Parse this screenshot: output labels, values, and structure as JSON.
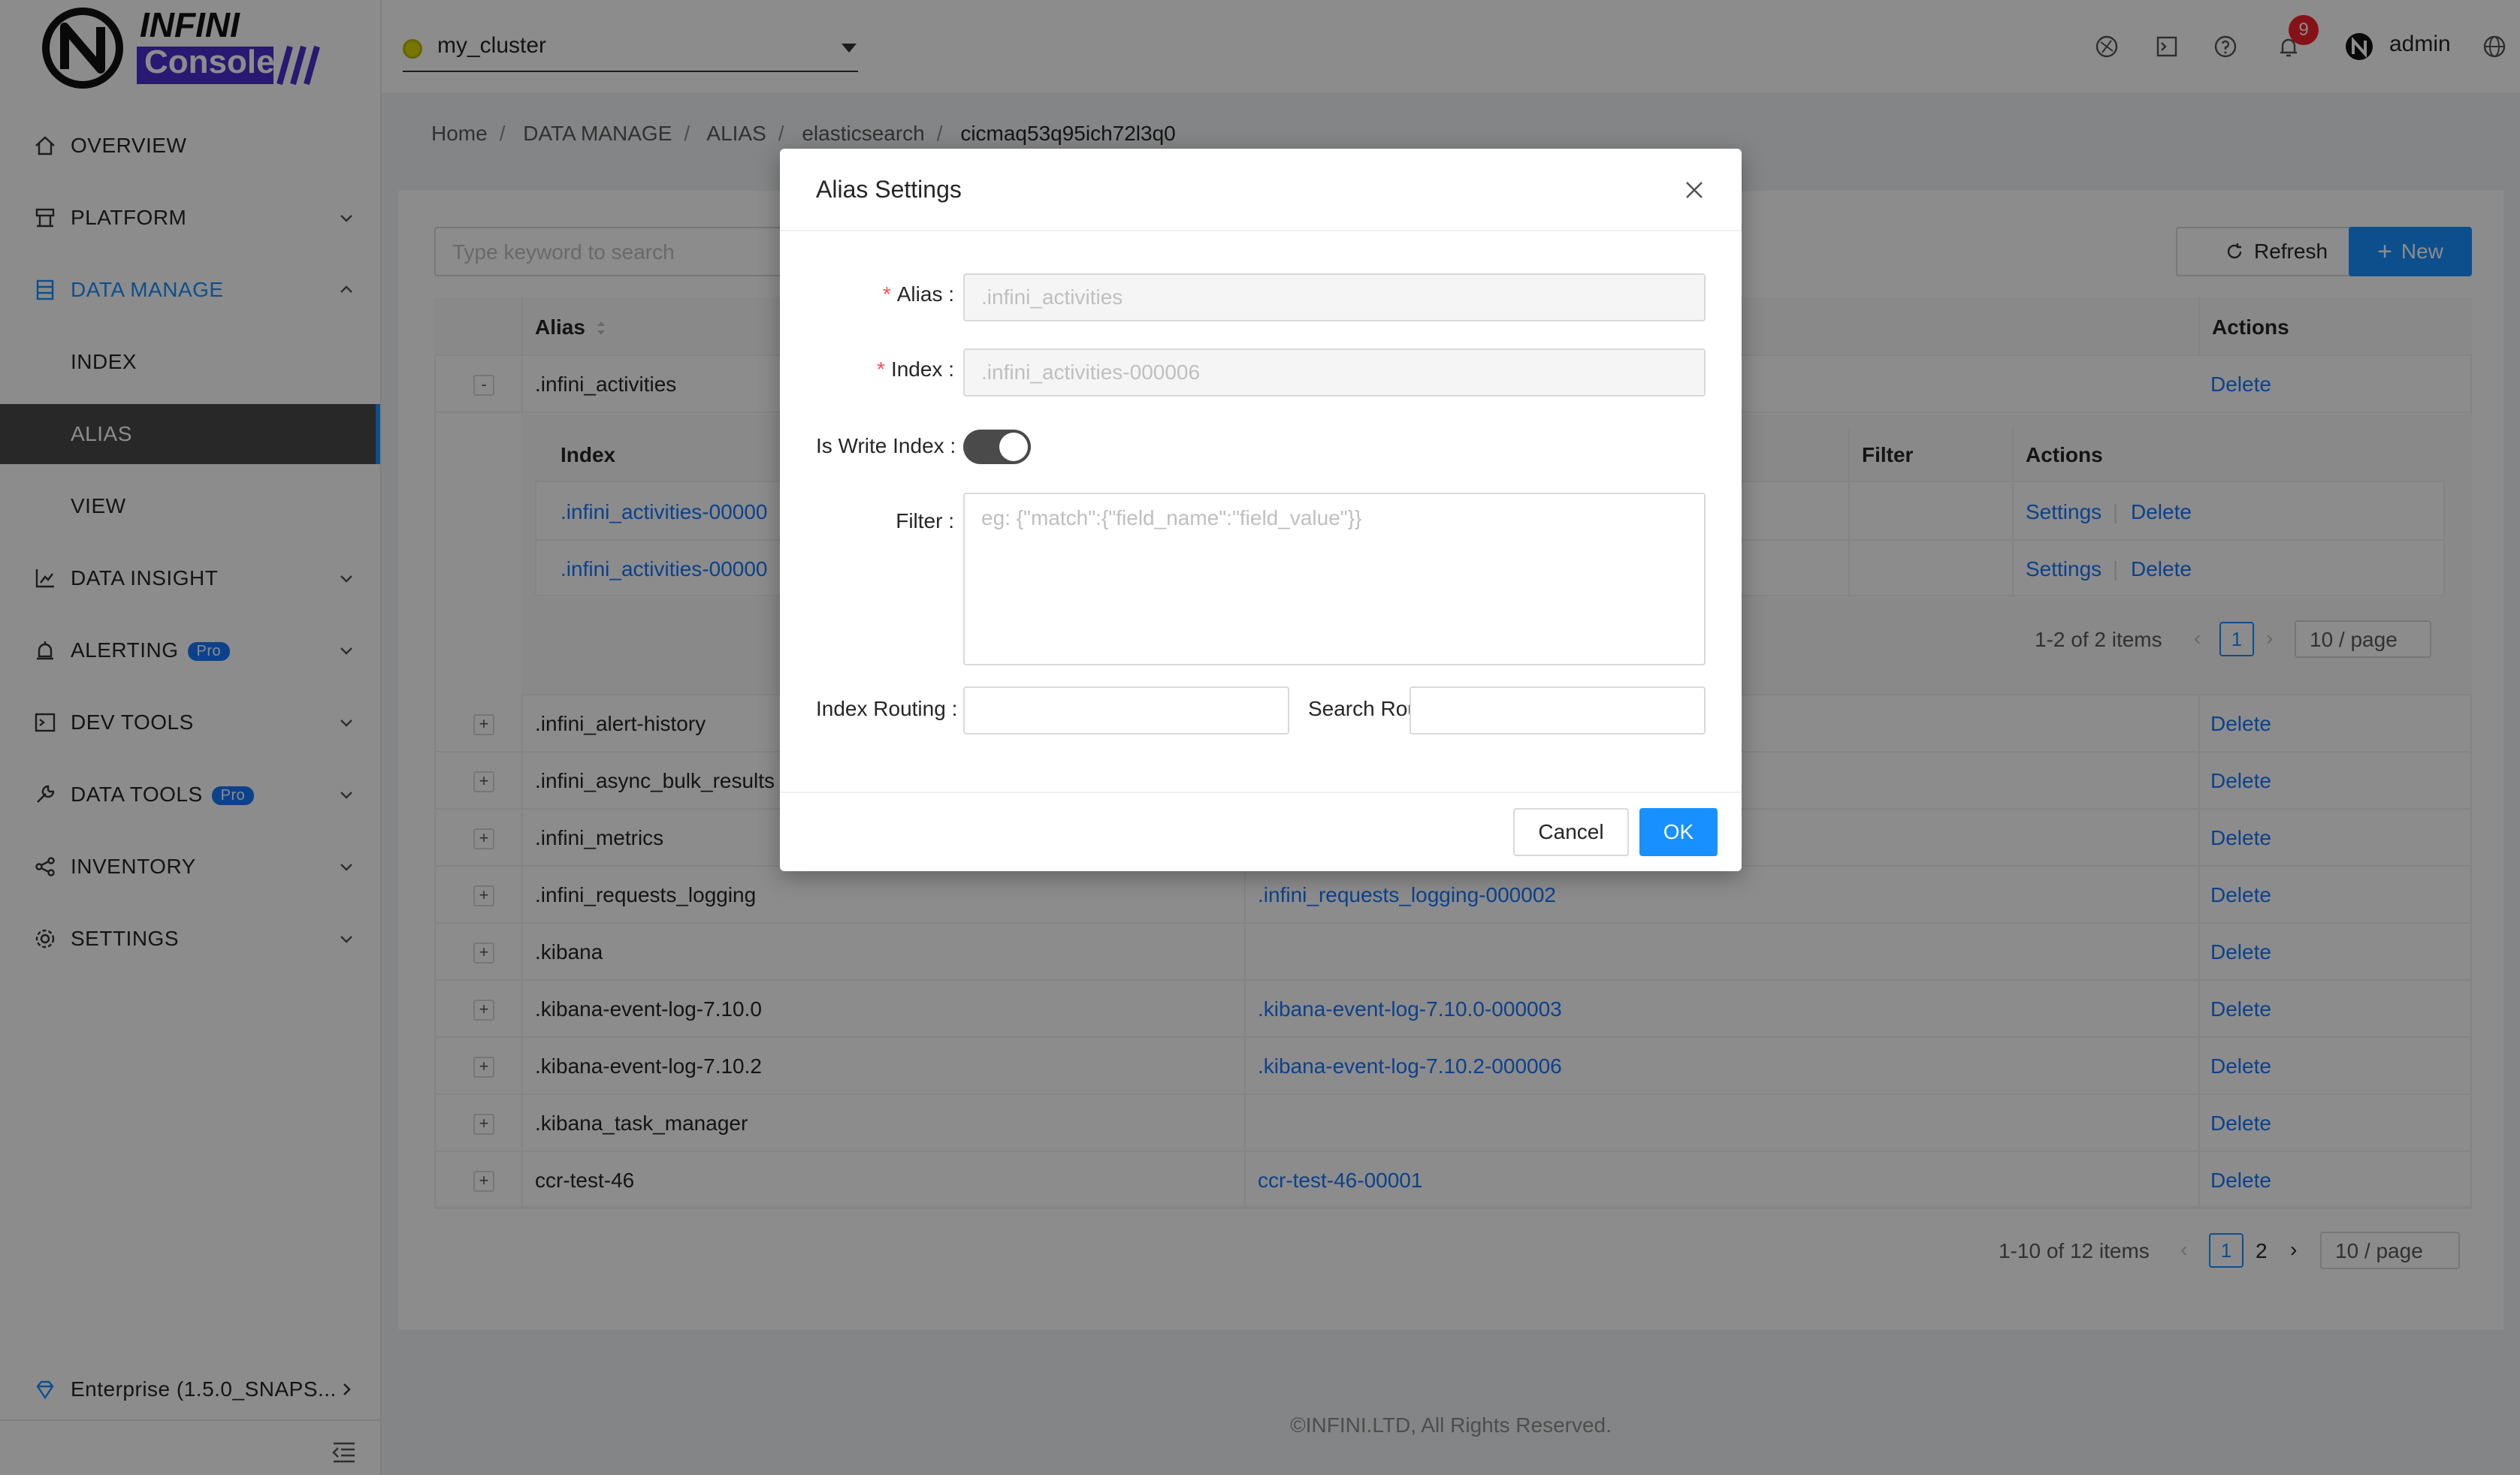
{
  "sidebar": {
    "logo_top": "INFINI",
    "logo_bottom": "Console",
    "items": [
      {
        "label": "OVERVIEW"
      },
      {
        "label": "PLATFORM"
      },
      {
        "label": "DATA MANAGE"
      },
      {
        "label": "INDEX"
      },
      {
        "label": "ALIAS"
      },
      {
        "label": "VIEW"
      },
      {
        "label": "DATA INSIGHT"
      },
      {
        "label": "ALERTING"
      },
      {
        "label": "DEV TOOLS"
      },
      {
        "label": "DATA TOOLS"
      },
      {
        "label": "INVENTORY"
      },
      {
        "label": "SETTINGS"
      }
    ],
    "pro_badge": "Pro",
    "enterprise": "Enterprise (1.5.0_SNAPS..."
  },
  "header": {
    "cluster": "my_cluster",
    "notifications": "9",
    "user": "admin"
  },
  "breadcrumb": [
    "Home",
    "DATA MANAGE",
    "ALIAS",
    "elasticsearch",
    "cicmaq53q95ich72l3q0"
  ],
  "toolbar": {
    "search_placeholder": "Type keyword to search",
    "refresh": "Refresh",
    "new": "New"
  },
  "table": {
    "headers": {
      "alias": "Alias",
      "actions": "Actions"
    },
    "expanded_row": {
      "alias": ".infini_activities",
      "action": "Delete"
    },
    "nested": {
      "headers": {
        "index": "Index",
        "filter": "Filter",
        "actions": "Actions"
      },
      "rows": [
        {
          "index": ".infini_activities-00000",
          "settings": "Settings",
          "delete": "Delete"
        },
        {
          "index": ".infini_activities-00000",
          "settings": "Settings",
          "delete": "Delete"
        }
      ],
      "pagination": {
        "summary": "1-2 of 2 items",
        "page": "1",
        "size": "10 / page"
      }
    },
    "rows": [
      {
        "expand": "+",
        "alias": ".infini_alert-history",
        "index": "",
        "action": "Delete"
      },
      {
        "expand": "+",
        "alias": ".infini_async_bulk_results",
        "index": "",
        "action": "Delete"
      },
      {
        "expand": "+",
        "alias": ".infini_metrics",
        "index": "",
        "action": "Delete"
      },
      {
        "expand": "+",
        "alias": ".infini_requests_logging",
        "index": ".infini_requests_logging-000002",
        "action": "Delete"
      },
      {
        "expand": "+",
        "alias": ".kibana",
        "index": "",
        "action": "Delete"
      },
      {
        "expand": "+",
        "alias": ".kibana-event-log-7.10.0",
        "index": ".kibana-event-log-7.10.0-000003",
        "action": "Delete"
      },
      {
        "expand": "+",
        "alias": ".kibana-event-log-7.10.2",
        "index": ".kibana-event-log-7.10.2-000006",
        "action": "Delete"
      },
      {
        "expand": "+",
        "alias": ".kibana_task_manager",
        "index": "",
        "action": "Delete"
      },
      {
        "expand": "+",
        "alias": "ccr-test-46",
        "index": "ccr-test-46-00001",
        "action": "Delete"
      }
    ],
    "pagination": {
      "summary": "1-10 of 12 items",
      "page1": "1",
      "page2": "2",
      "size": "10 / page"
    }
  },
  "footer": "©INFINI.LTD, All Rights Reserved.",
  "modal": {
    "title": "Alias Settings",
    "alias_label": "Alias :",
    "alias_value": ".infini_activities",
    "index_label": "Index :",
    "index_value": ".infini_activities-000006",
    "write_label": "Is Write Index :",
    "write_on": true,
    "filter_label": "Filter :",
    "filter_placeholder": "eg:  {\"match\":{\"field_name\":\"field_value\"}}",
    "index_routing_label": "Index Routing :",
    "search_routing_label": "Search Routing",
    "cancel": "Cancel",
    "ok": "OK"
  },
  "colors": {
    "primary": "#1890ff",
    "required": "#ff4d4f",
    "overlay": "rgba(0,0,0,0.45)"
  }
}
